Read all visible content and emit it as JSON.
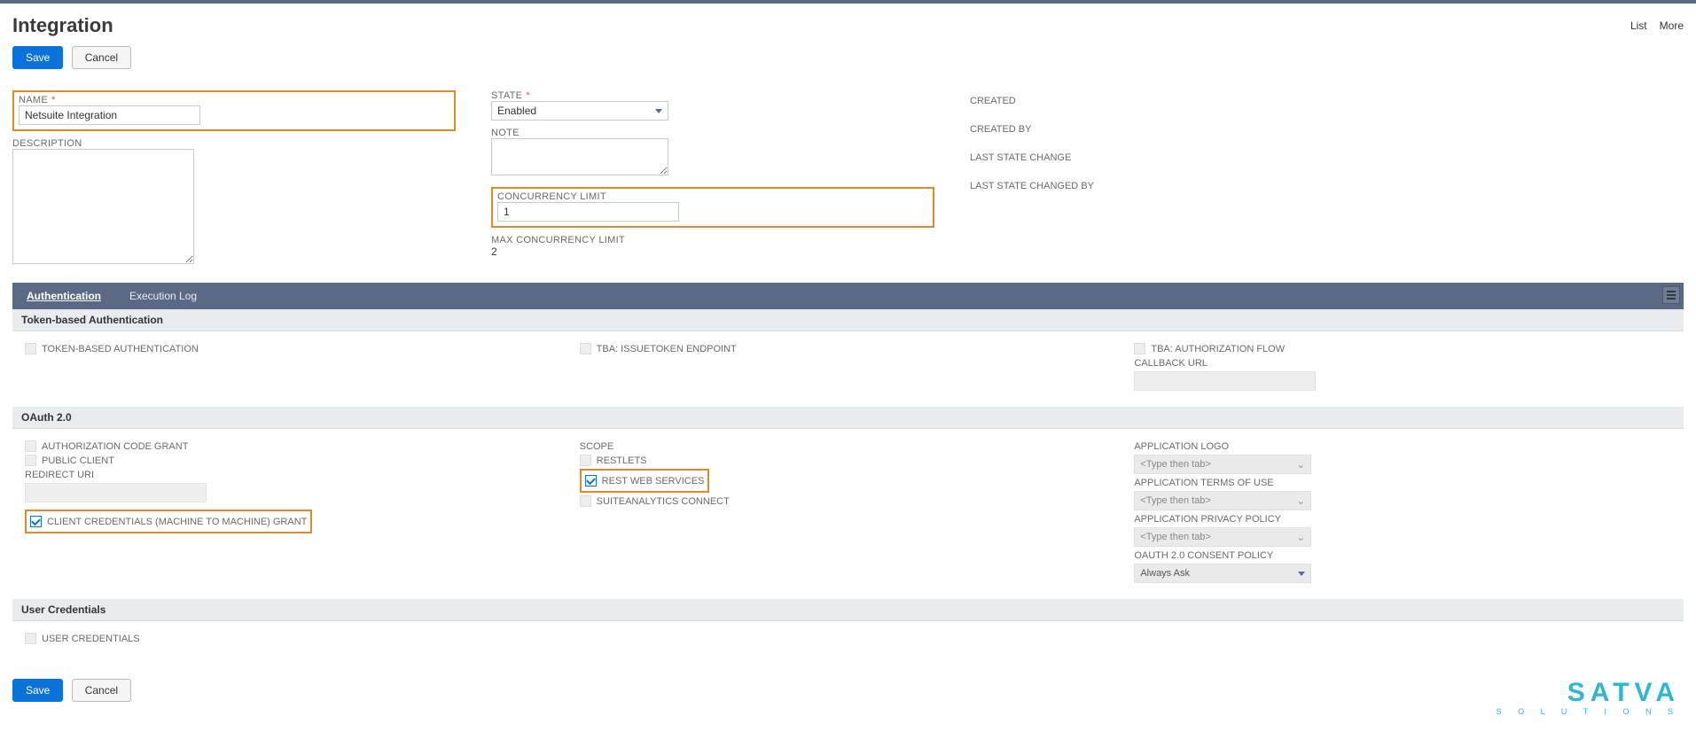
{
  "header": {
    "title": "Integration",
    "links": {
      "list": "List",
      "more": "More"
    }
  },
  "buttons": {
    "save": "Save",
    "cancel": "Cancel"
  },
  "form": {
    "name_label": "NAME",
    "name_value": "Netsuite Integration",
    "description_label": "DESCRIPTION",
    "description_value": "",
    "state_label": "STATE",
    "state_value": "Enabled",
    "note_label": "NOTE",
    "note_value": "",
    "concurrency_label": "CONCURRENCY LIMIT",
    "concurrency_value": "1",
    "max_concurrency_label": "MAX CONCURRENCY LIMIT",
    "max_concurrency_value": "2",
    "meta": {
      "created": "CREATED",
      "created_by": "CREATED BY",
      "last_state_change": "LAST STATE CHANGE",
      "last_state_changed_by": "LAST STATE CHANGED BY"
    }
  },
  "tabs": {
    "authentication": "Authentication",
    "execution_log": "Execution Log"
  },
  "token_auth": {
    "section": "Token-based Authentication",
    "tba": "TOKEN-BASED AUTHENTICATION",
    "issuetoken": "TBA: ISSUETOKEN ENDPOINT",
    "authflow": "TBA: AUTHORIZATION FLOW",
    "callback_label": "CALLBACK URL"
  },
  "oauth": {
    "section": "OAuth 2.0",
    "auth_code": "AUTHORIZATION CODE GRANT",
    "public_client": "PUBLIC CLIENT",
    "redirect_label": "REDIRECT URI",
    "client_creds": "CLIENT CREDENTIALS (MACHINE TO MACHINE) GRANT",
    "scope_label": "SCOPE",
    "restlets": "RESTLETS",
    "rest_ws": "REST WEB SERVICES",
    "suiteanalytics": "SUITEANALYTICS CONNECT",
    "app_logo_label": "APPLICATION LOGO",
    "app_terms_label": "APPLICATION TERMS OF USE",
    "app_privacy_label": "APPLICATION PRIVACY POLICY",
    "consent_label": "OAUTH 2.0 CONSENT POLICY",
    "consent_value": "Always Ask",
    "type_placeholder": "<Type then tab>"
  },
  "user_creds": {
    "section": "User Credentials",
    "user_creds_label": "USER CREDENTIALS"
  },
  "brand": {
    "main": "SATVA",
    "sub": "S O L U T I O N S"
  }
}
